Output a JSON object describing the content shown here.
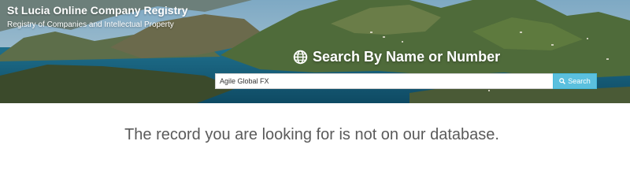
{
  "header": {
    "title": "St Lucia Online Company Registry",
    "subtitle": "Registry of Companies and Intellectual Property"
  },
  "search": {
    "heading": "Search By Name or Number",
    "heading_icon": "globe-icon",
    "value": "Agile Global FX",
    "button_label": "Search",
    "button_icon": "search-icon"
  },
  "result": {
    "message": "The record you are looking for is not on our database."
  },
  "colors": {
    "button": "#5bc0de",
    "message_text": "#5a5a5a"
  }
}
